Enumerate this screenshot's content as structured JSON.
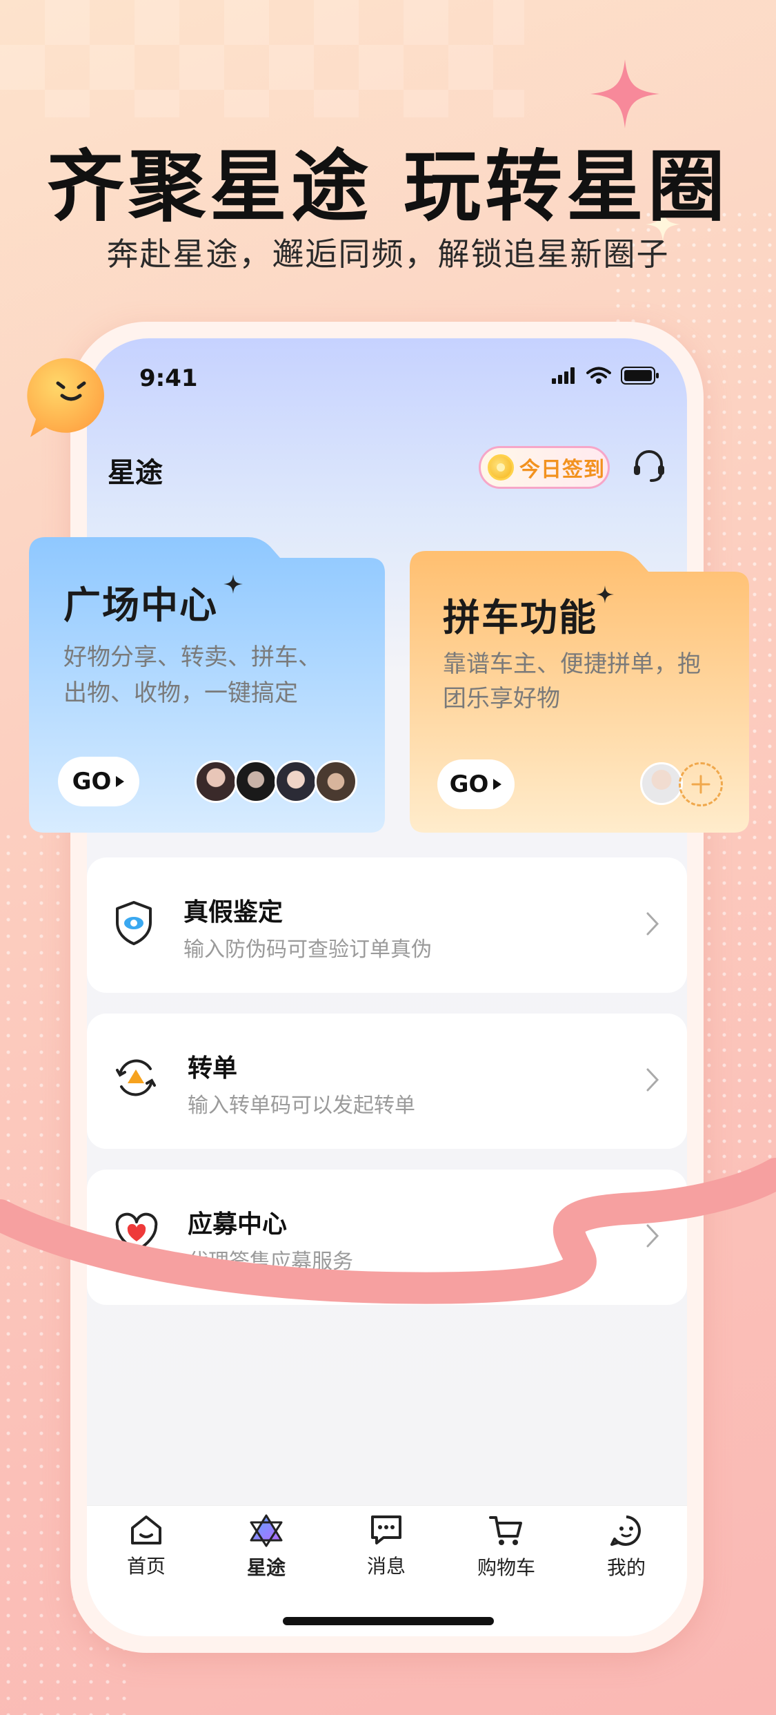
{
  "promo": {
    "headline": "齐聚星途 玩转星圈",
    "subline": "奔赴星途，邂逅同频，解锁追星新圈子"
  },
  "status_bar": {
    "time": "9:41"
  },
  "header": {
    "title": "星途",
    "checkin_label": "今日签到"
  },
  "feature_cards": [
    {
      "title": "广场中心",
      "desc_line1": "好物分享、转卖、拼车、",
      "desc_line2": "出物、收物，一键搞定",
      "go_label": "GO"
    },
    {
      "title": "拼车功能",
      "desc_line1": "靠谱车主、便捷拼单，抱",
      "desc_line2": "团乐享好物",
      "go_label": "GO"
    }
  ],
  "menu": [
    {
      "title": "真假鉴定",
      "subtitle": "输入防伪码可查验订单真伪",
      "icon": "shield-eye-icon"
    },
    {
      "title": "转单",
      "subtitle": "输入转单码可以发起转单",
      "icon": "transfer-icon"
    },
    {
      "title": "应募中心",
      "subtitle": "代理签售应募服务",
      "icon": "heart-icon"
    }
  ],
  "tabbar": [
    {
      "label": "首页",
      "icon": "home-icon",
      "active": false
    },
    {
      "label": "星途",
      "icon": "star-icon",
      "active": true
    },
    {
      "label": "消息",
      "icon": "message-icon",
      "active": false
    },
    {
      "label": "购物车",
      "icon": "cart-icon",
      "active": false
    },
    {
      "label": "我的",
      "icon": "profile-icon",
      "active": false
    }
  ],
  "colors": {
    "accent_orange": "#f2921f",
    "blue_card": "#a9d4ff",
    "orange_card": "#ffc98a",
    "ribbon": "#f6a0a0"
  }
}
